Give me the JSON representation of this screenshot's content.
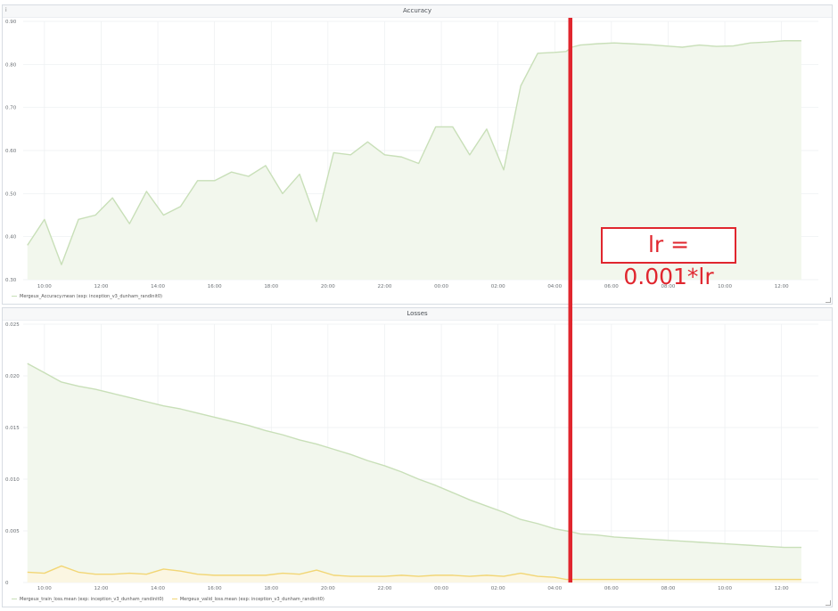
{
  "colors": {
    "train_line": "#c8dfb8",
    "train_fill": "#f1f7ec",
    "valid_line": "#f2d675",
    "valid_fill": "#fbf6e2",
    "marker": "#e0262e",
    "grid": "#eceff1",
    "tick": "#6b7075"
  },
  "icons": [
    "info-icon",
    "resize-icon"
  ],
  "annotation": {
    "label": "lr = 0.001*lr",
    "at_x": 4.55
  },
  "chart_data": [
    {
      "type": "area",
      "title": "Accuracy",
      "xlabel": "",
      "ylabel": "",
      "x_tick_labels": [
        "10:00",
        "12:00",
        "14:00",
        "16:00",
        "18:00",
        "20:00",
        "22:00",
        "00:00",
        "02:00",
        "04:00",
        "06:00",
        "08:00",
        "10:00",
        "12:00"
      ],
      "x_tick_values": [
        -14,
        -12,
        -10,
        -8,
        -6,
        -4,
        -2,
        0,
        2,
        4,
        6,
        8,
        10,
        12
      ],
      "xlim": [
        -14.75,
        13.3
      ],
      "y_ticks": [
        0.3,
        0.4,
        0.5,
        0.6,
        0.7,
        0.8,
        0.9
      ],
      "y_tick_labels": [
        "0.30",
        "0.40",
        "0.50",
        "0.60",
        "0.70",
        "0.80",
        "0.90"
      ],
      "ylim": [
        0.3,
        0.9
      ],
      "grid": true,
      "legend_position": "bottom-left",
      "series": [
        {
          "name": "Mergeux_Accuracy.mean (exp: inception_v3_dunham_randinit0)",
          "x": [
            -14.6,
            -14.0,
            -13.4,
            -12.8,
            -12.2,
            -11.6,
            -11.0,
            -10.4,
            -9.8,
            -9.2,
            -8.6,
            -8.0,
            -7.4,
            -6.8,
            -6.2,
            -5.6,
            -5.0,
            -4.4,
            -3.8,
            -3.2,
            -2.6,
            -2.0,
            -1.4,
            -0.8,
            -0.2,
            0.4,
            1.0,
            1.6,
            2.2,
            2.8,
            3.4,
            4.0,
            4.4,
            4.6,
            4.9,
            5.5,
            6.1,
            6.7,
            7.3,
            7.9,
            8.5,
            9.1,
            9.7,
            10.3,
            10.9,
            11.5,
            12.1,
            12.7
          ],
          "values": [
            0.38,
            0.44,
            0.335,
            0.44,
            0.45,
            0.49,
            0.43,
            0.505,
            0.45,
            0.47,
            0.53,
            0.53,
            0.55,
            0.54,
            0.565,
            0.5,
            0.545,
            0.435,
            0.595,
            0.59,
            0.62,
            0.59,
            0.585,
            0.57,
            0.655,
            0.655,
            0.59,
            0.65,
            0.555,
            0.75,
            0.826,
            0.828,
            0.83,
            0.84,
            0.845,
            0.848,
            0.85,
            0.848,
            0.846,
            0.843,
            0.84,
            0.845,
            0.842,
            0.843,
            0.85,
            0.852,
            0.855,
            0.855
          ]
        }
      ]
    },
    {
      "type": "area",
      "title": "Losses",
      "xlabel": "",
      "ylabel": "",
      "x_tick_labels": [
        "10:00",
        "12:00",
        "14:00",
        "16:00",
        "18:00",
        "20:00",
        "22:00",
        "00:00",
        "02:00",
        "04:00",
        "06:00",
        "08:00",
        "10:00",
        "12:00"
      ],
      "x_tick_values": [
        -14,
        -12,
        -10,
        -8,
        -6,
        -4,
        -2,
        0,
        2,
        4,
        6,
        8,
        10,
        12
      ],
      "xlim": [
        -14.75,
        13.3
      ],
      "y_ticks": [
        0,
        0.005,
        0.01,
        0.015,
        0.02,
        0.025
      ],
      "y_tick_labels": [
        "0",
        "0.005",
        "0.010",
        "0.015",
        "0.020",
        "0.025"
      ],
      "ylim": [
        0,
        0.025
      ],
      "grid": true,
      "legend_position": "bottom-left",
      "series": [
        {
          "name": "Mergeux_train_loss.mean (exp: inception_v3_dunham_randinit0)",
          "x": [
            -14.6,
            -14.0,
            -13.4,
            -12.8,
            -12.2,
            -11.6,
            -11.0,
            -10.4,
            -9.8,
            -9.2,
            -8.6,
            -8.0,
            -7.4,
            -6.8,
            -6.2,
            -5.6,
            -5.0,
            -4.4,
            -3.8,
            -3.2,
            -2.6,
            -2.0,
            -1.4,
            -0.8,
            -0.2,
            0.4,
            1.0,
            1.6,
            2.2,
            2.8,
            3.4,
            4.0,
            4.4,
            4.6,
            4.9,
            5.5,
            6.1,
            6.7,
            7.3,
            7.9,
            8.5,
            9.1,
            9.7,
            10.3,
            10.9,
            11.5,
            12.1,
            12.7
          ],
          "values": [
            0.0212,
            0.0203,
            0.0194,
            0.019,
            0.0187,
            0.0183,
            0.0179,
            0.0175,
            0.0171,
            0.0168,
            0.0164,
            0.016,
            0.0156,
            0.0152,
            0.0147,
            0.0143,
            0.0138,
            0.0134,
            0.0129,
            0.0124,
            0.0118,
            0.0113,
            0.0107,
            0.01,
            0.0094,
            0.0087,
            0.008,
            0.0074,
            0.0068,
            0.0061,
            0.0057,
            0.0052,
            0.005,
            0.0049,
            0.0047,
            0.0046,
            0.0044,
            0.0043,
            0.0042,
            0.0041,
            0.004,
            0.0039,
            0.0038,
            0.0037,
            0.0036,
            0.0035,
            0.0034,
            0.0034
          ]
        },
        {
          "name": "Mergeux_valid_loss.mean (exp: inception_v3_dunham_randinit0)",
          "x": [
            -14.6,
            -14.0,
            -13.4,
            -12.8,
            -12.2,
            -11.6,
            -11.0,
            -10.4,
            -9.8,
            -9.2,
            -8.6,
            -8.0,
            -7.4,
            -6.8,
            -6.2,
            -5.6,
            -5.0,
            -4.4,
            -3.8,
            -3.2,
            -2.6,
            -2.0,
            -1.4,
            -0.8,
            -0.2,
            0.4,
            1.0,
            1.6,
            2.2,
            2.8,
            3.4,
            4.0,
            4.4,
            4.6,
            4.9,
            5.5,
            6.1,
            6.7,
            7.3,
            7.9,
            8.5,
            9.1,
            9.7,
            10.3,
            10.9,
            11.5,
            12.1,
            12.7
          ],
          "values": [
            0.001,
            0.0009,
            0.0016,
            0.001,
            0.0008,
            0.0008,
            0.0009,
            0.0008,
            0.0013,
            0.0011,
            0.0008,
            0.0007,
            0.0007,
            0.0007,
            0.0007,
            0.0009,
            0.0008,
            0.0012,
            0.0007,
            0.0006,
            0.0006,
            0.0006,
            0.0007,
            0.0006,
            0.0007,
            0.0007,
            0.0006,
            0.0007,
            0.0006,
            0.0009,
            0.0006,
            0.0005,
            0.0003,
            0.0003,
            0.0003,
            0.0003,
            0.0003,
            0.0003,
            0.0003,
            0.0003,
            0.0003,
            0.0003,
            0.0003,
            0.0003,
            0.0003,
            0.0003,
            0.0003,
            0.0003
          ]
        }
      ]
    }
  ]
}
